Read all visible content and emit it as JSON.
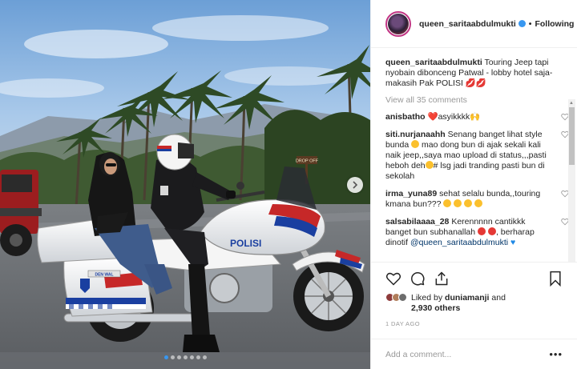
{
  "post": {
    "username": "queen_saritaabdulmukti",
    "follow_label": "Following",
    "photo_text": {
      "plate_label": "POLISI",
      "bag_label": "DEN WAL",
      "sign_label": "DROP OFF"
    },
    "carousel": {
      "dot_count": 7,
      "active_index": 0
    }
  },
  "caption": {
    "username": "queen_saritaabdulmukti",
    "text": "Touring Jeep tapi nyobain dibonceng Patwal - lobby hotel saja- makasih Pak POLISI",
    "emoji": "💋💋"
  },
  "view_all": "View all 35 comments",
  "comments": [
    {
      "user": "anisbatho",
      "text": "asyikkkk",
      "emoji_pre": "❤️",
      "emoji_post": "🙌"
    },
    {
      "user": "siti.nurjanaahh",
      "text": "Senang banget lihat style bunda",
      "text2": "mao dong bun di ajak sekali kali naik jeep,,saya mao upload di status,,,pasti heboh deh",
      "text3": "# lsg jadi tranding pasti bun di sekolah"
    },
    {
      "user": "irma_yuna89",
      "text": "sehat selalu bunda,,touring kmana bun???"
    },
    {
      "user": "salsabilaaaa_28",
      "text": "Kerennnnn cantikkk banget bun subhanallah",
      "text2": ", berharap dinotif",
      "mention": "@queen_saritaabdulmukti"
    }
  ],
  "likes": {
    "prefix": "Liked by",
    "user": "duniamanji",
    "and": "and",
    "count": "2,930 others"
  },
  "date": "1 DAY AGO",
  "add_comment": {
    "placeholder": "Add a comment...",
    "more": "•••"
  }
}
